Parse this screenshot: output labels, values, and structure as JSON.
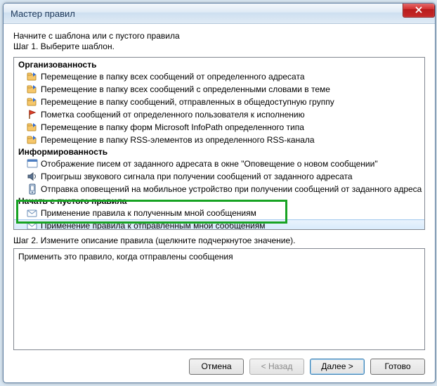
{
  "window": {
    "title": "Мастер правил"
  },
  "intro": {
    "line1": "Начните с шаблона или с пустого правила",
    "line2": "Шаг 1. Выберите шаблон."
  },
  "groups": {
    "g0": {
      "header": "Организованность",
      "i0": {
        "icon": "folder-move",
        "label": "Перемещение в папку всех сообщений от определенного адресата"
      },
      "i1": {
        "icon": "folder-move",
        "label": "Перемещение в папку всех сообщений с определенными словами в теме"
      },
      "i2": {
        "icon": "folder-move",
        "label": "Перемещение в папку сообщений, отправленных в общедоступную группу"
      },
      "i3": {
        "icon": "flag",
        "label": "Пометка сообщений от определенного пользователя к исполнению"
      },
      "i4": {
        "icon": "folder-move",
        "label": "Перемещение в папку форм Microsoft InfoPath определенного типа"
      },
      "i5": {
        "icon": "folder-move",
        "label": "Перемещение в папку RSS-элементов из определенного RSS-канала"
      }
    },
    "g1": {
      "header": "Информированность",
      "i0": {
        "icon": "window",
        "label": "Отображение писем от заданного адресата в окне \"Оповещение о новом сообщении\""
      },
      "i1": {
        "icon": "speaker",
        "label": "Проигрыш звукового сигнала при получении сообщений от заданного адресата"
      },
      "i2": {
        "icon": "mobile",
        "label": "Отправка оповещений на мобильное устройство при получении сообщений от заданного адреса"
      }
    },
    "g2": {
      "header": "Начать с пустого правила",
      "i0": {
        "icon": "mail-in",
        "label": "Применение правила к полученным мной сообщениям"
      },
      "i1": {
        "icon": "mail-out",
        "label": "Применение правила к отправленным мной сообщениям"
      }
    }
  },
  "step2": {
    "label": "Шаг 2. Измените описание правила (щелкните подчеркнутое значение).",
    "description": "Применить это правило, когда отправлены сообщения"
  },
  "buttons": {
    "cancel": "Отмена",
    "back": "< Назад",
    "next": "Далее >",
    "finish": "Готово"
  }
}
